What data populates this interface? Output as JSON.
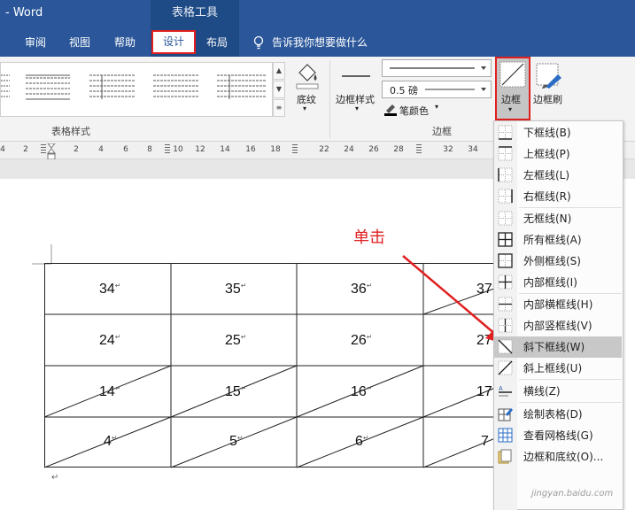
{
  "app": {
    "title": "- Word",
    "context_title": "表格工具"
  },
  "tabs": [
    {
      "label": "审阅"
    },
    {
      "label": "视图"
    },
    {
      "label": "帮助"
    },
    {
      "label": "设计"
    },
    {
      "label": "布局"
    }
  ],
  "tell_me": "告诉我你想要做什么",
  "ribbon": {
    "table_styles_label": "表格样式",
    "shading_label": "底纹",
    "border_styles_label": "边框样式",
    "line_weight": "0.5 磅",
    "pen_color_label": "笔颜色",
    "borders_group_label": "边框",
    "borders_button_label": "边框",
    "border_painter_label": "边框刷"
  },
  "ruler": {
    "left": [
      "4",
      "2"
    ],
    "numbers": [
      "2",
      "4",
      "6",
      "8",
      "10",
      "12",
      "14",
      "16",
      "18",
      "22",
      "24",
      "26",
      "28",
      "32",
      "34"
    ]
  },
  "table": {
    "rows": [
      [
        "34",
        "35",
        "36",
        "37"
      ],
      [
        "24",
        "25",
        "26",
        "27"
      ],
      [
        "14",
        "15",
        "16",
        "17"
      ],
      [
        "4",
        "5",
        "6",
        "7"
      ]
    ],
    "para_mark": "↵"
  },
  "annotation": {
    "click_label": "单击"
  },
  "menu": {
    "items": [
      {
        "label": "下框线(B)",
        "icon": "bottom-border-icon"
      },
      {
        "label": "上框线(P)",
        "icon": "top-border-icon"
      },
      {
        "label": "左框线(L)",
        "icon": "left-border-icon"
      },
      {
        "label": "右框线(R)",
        "icon": "right-border-icon"
      },
      {
        "label": "无框线(N)",
        "icon": "no-border-icon"
      },
      {
        "label": "所有框线(A)",
        "icon": "all-borders-icon"
      },
      {
        "label": "外侧框线(S)",
        "icon": "outside-borders-icon"
      },
      {
        "label": "内部框线(I)",
        "icon": "inside-borders-icon"
      },
      {
        "label": "内部横框线(H)",
        "icon": "inside-horizontal-border-icon"
      },
      {
        "label": "内部竖框线(V)",
        "icon": "inside-vertical-border-icon"
      },
      {
        "label": "斜下框线(W)",
        "icon": "diagonal-down-border-icon"
      },
      {
        "label": "斜上框线(U)",
        "icon": "diagonal-up-border-icon"
      },
      {
        "label": "横线(Z)",
        "icon": "horizontal-line-icon"
      },
      {
        "label": "绘制表格(D)",
        "icon": "draw-table-icon"
      },
      {
        "label": "查看网格线(G)",
        "icon": "view-gridlines-icon"
      },
      {
        "label": "边框和底纹(O)...",
        "icon": "borders-shading-icon"
      }
    ],
    "highlighted_index": 10
  },
  "watermark": "jingyan.baidu.com",
  "colors": {
    "ribbon_blue": "#2b579a",
    "highlight_red": "#e02020",
    "menu_highlight": "#c8c8c8"
  }
}
